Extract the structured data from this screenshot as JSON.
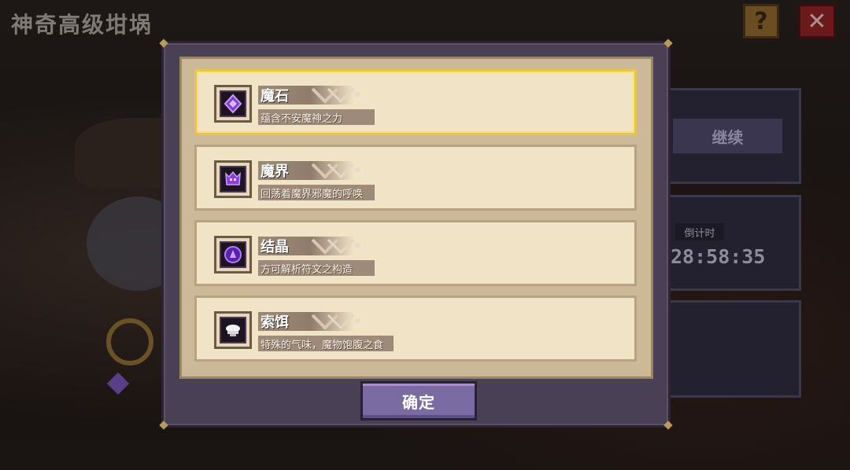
{
  "screen_title": "神奇高级坩埚",
  "top_buttons": {
    "help_label": "?",
    "close_label": "✕"
  },
  "side": {
    "continue_label": "继续",
    "countdown_label": "倒计时",
    "countdown_value": "28:58:35"
  },
  "modal": {
    "items": [
      {
        "name": "魔石",
        "description": "蕴含不安魔神之力",
        "icon": "magic-stone-icon",
        "selected": true
      },
      {
        "name": "魔界",
        "description": "回荡着魔界邪魔的呼唤",
        "icon": "demon-realm-icon",
        "selected": false
      },
      {
        "name": "结晶",
        "description": "方可解析符文之构造",
        "icon": "crystal-icon",
        "selected": false
      },
      {
        "name": "索饵",
        "description": "特殊的气味，魔物饱腹之食",
        "icon": "bait-icon",
        "selected": false
      }
    ],
    "confirm_label": "确定"
  },
  "colors": {
    "item_background": "#f1e4c6",
    "selected_border": "#e7c44c",
    "confirm_button": "#7a6ba3",
    "modal_frame": "#4a4056"
  }
}
